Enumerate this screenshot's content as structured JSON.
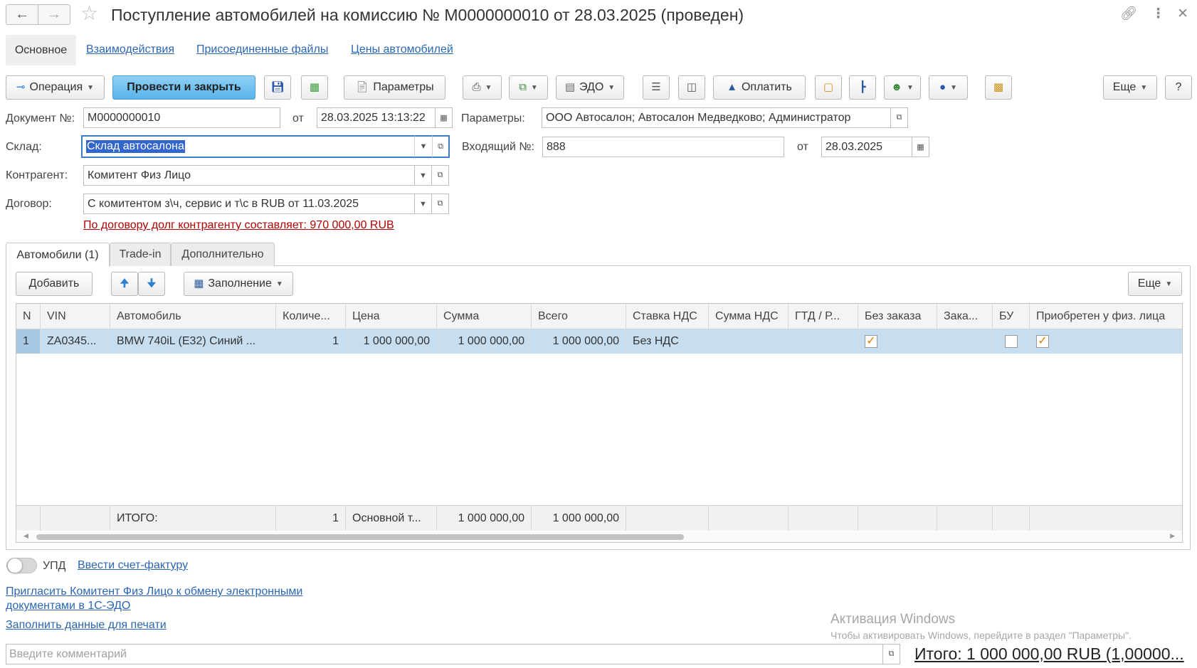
{
  "header": {
    "title": "Поступление автомобилей на комиссию № М0000000010 от 28.03.2025 (проведен)"
  },
  "sections": {
    "main": "Основное",
    "links": [
      "Взаимодействия",
      "Присоединенные файлы",
      "Цены автомобилей"
    ]
  },
  "toolbar": {
    "operation": "Операция",
    "post_close": "Провести и закрыть",
    "params": "Параметры",
    "edo": "ЭДО",
    "pay": "Оплатить",
    "more": "Еще",
    "help": "?"
  },
  "form": {
    "doc_no_label": "Документ №:",
    "doc_no": "М0000000010",
    "from_label": "от",
    "doc_date": "28.03.2025 13:13:22",
    "params_label": "Параметры:",
    "params_value": "ООО Автосалон; Автосалон Медведково; Администратор",
    "warehouse_label": "Склад:",
    "warehouse": "Склад автосалона",
    "incoming_label": "Входящий №:",
    "incoming_no": "888",
    "incoming_from_label": "от",
    "incoming_date": "28.03.2025",
    "counterparty_label": "Контрагент:",
    "counterparty": "Комитент Физ Лицо",
    "contract_label": "Договор:",
    "contract": "С комитентом з\\ч, сервис и т\\с в RUB от 11.03.2025",
    "debt_warning": "По договору долг контрагенту составляет: 970 000,00 RUB"
  },
  "tabs": [
    "Автомобили (1)",
    "Trade-in",
    "Дополнительно"
  ],
  "table_toolbar": {
    "add": "Добавить",
    "fill": "Заполнение",
    "more": "Еще"
  },
  "table": {
    "headers": [
      "N",
      "VIN",
      "Автомобиль",
      "Количе...",
      "Цена",
      "Сумма",
      "Всего",
      "Ставка НДС",
      "Сумма НДС",
      "ГТД / Р...",
      "Без заказа",
      "Зака...",
      "БУ",
      "Приобретен у физ. лица"
    ],
    "row": {
      "n": "1",
      "vin": "ZA0345...",
      "car": "BMW 740iL (E32) Синий ...",
      "qty": "1",
      "price": "1 000 000,00",
      "sum": "1 000 000,00",
      "total": "1 000 000,00",
      "vat_rate": "Без НДС",
      "no_order": true,
      "used": false,
      "from_individual": true
    },
    "footer": {
      "label": "ИТОГО:",
      "qty": "1",
      "price": "Основной т...",
      "sum": "1 000 000,00",
      "total": "1 000 000,00"
    }
  },
  "footer": {
    "upd_label": "УПД",
    "invoice_link": "Ввести счет-фактуру",
    "invite_link_1": "Пригласить Комитент Физ Лицо к обмену электронными",
    "invite_link_2": "документами в 1С-ЭДО",
    "print_link": "Заполнить данные для печати",
    "comment_placeholder": "Введите комментарий",
    "total": "Итого: 1 000 000,00 RUB (1,00000..."
  },
  "watermark": {
    "line1": "Активация Windows",
    "line2": "Чтобы активировать Windows, перейдите в раздел \"Параметры\"."
  }
}
